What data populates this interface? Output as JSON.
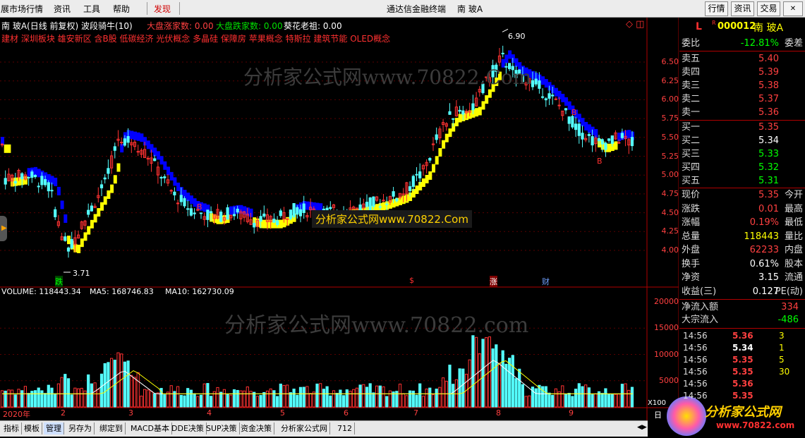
{
  "menu": {
    "items": [
      "展市场行情",
      "资讯",
      "工具",
      "帮助",
      "发现"
    ],
    "title": "通达信金融终端",
    "stock_title": "南 玻A",
    "right_buttons": [
      "行情",
      "资讯",
      "交易"
    ],
    "window_icons": [
      "▬",
      "▭",
      "✕"
    ]
  },
  "chart": {
    "stock_line": "南 玻A(日线 前复权) 波段骑牛(10)",
    "up_count_label": "大盘涨家数: 0.00",
    "down_count_label": "大盘跌家数: 0.00",
    "extra_label": "葵花老祖: 0.00",
    "concepts": "建材 深圳板块 雄安新区 含B股 低碳经济 光伏概念 多晶硅 保障房 苹果概念 特斯拉 建筑节能 OLED概念",
    "high_label": "6.90",
    "low_label": "3.71",
    "price_ticks": [
      "6.50",
      "6.25",
      "6.00",
      "5.75",
      "5.50",
      "5.25",
      "5.00",
      "4.75",
      "4.50",
      "4.25",
      "4.00"
    ],
    "event_tags": [
      "跌",
      "$",
      "涨",
      "财"
    ],
    "b_marks": [
      "B",
      "B",
      "B"
    ],
    "watermark1": "分析家公式网www.70822.Com",
    "watermark2": "分析家公式网www.70822.Com",
    "colors": {
      "up": "#ff3232",
      "down": "#54ffff",
      "band_up": "#ffff00",
      "band_down": "#0000ff",
      "ma": "#ffffff"
    }
  },
  "volume": {
    "label": "VOLUME: 118443.34",
    "ma5": "MA5: 168746.83",
    "ma10": "MA10: 162730.09",
    "ticks": [
      "20000",
      "15000",
      "10000",
      "5000"
    ],
    "unit": "X100",
    "watermark": "分析家公式网www.70822.com"
  },
  "date_axis": {
    "labels": [
      "2020年",
      "2",
      "3",
      "4",
      "5",
      "6",
      "7",
      "8",
      "9"
    ],
    "right_label": "日"
  },
  "bottom_tabs": [
    "指标",
    "模板",
    "管理",
    "另存为",
    "绑定到",
    "MACD基本",
    "DDE决策",
    "SUP决策",
    "资金决策",
    "分析家公式网",
    "712"
  ],
  "quote": {
    "market_icon": "L",
    "code": "000012",
    "name": "南 玻A",
    "r_icon": "R",
    "webi_label": "委比",
    "webi_value": "-12.81%",
    "weicha_label": "委差",
    "asks": [
      {
        "label": "卖五",
        "price": "5.40"
      },
      {
        "label": "卖四",
        "price": "5.39"
      },
      {
        "label": "卖三",
        "price": "5.38"
      },
      {
        "label": "卖二",
        "price": "5.37"
      },
      {
        "label": "卖一",
        "price": "5.36"
      }
    ],
    "bids": [
      {
        "label": "买一",
        "price": "5.35"
      },
      {
        "label": "买二",
        "price": "5.34"
      },
      {
        "label": "买三",
        "price": "5.33"
      },
      {
        "label": "买四",
        "price": "5.32"
      },
      {
        "label": "买五",
        "price": "5.31"
      }
    ],
    "stats": [
      {
        "label": "现价",
        "value": "5.35",
        "right": "今开"
      },
      {
        "label": "涨跌",
        "value": "0.01",
        "right": "最高"
      },
      {
        "label": "涨幅",
        "value": "0.19%",
        "right": "最低"
      },
      {
        "label": "总量",
        "value": "118443",
        "right": "量比"
      },
      {
        "label": "外盘",
        "value": "62233",
        "right": "内盘"
      },
      {
        "label": "换手",
        "value": "0.61%",
        "right": "股本"
      },
      {
        "label": "净资",
        "value": "3.15",
        "right": "流通"
      },
      {
        "label": "收益(三)",
        "value": "0.127",
        "right": "PE(动)"
      }
    ],
    "flow": [
      {
        "label": "净流入额",
        "value": "334"
      },
      {
        "label": "大宗流入",
        "value": "-486"
      }
    ],
    "ticks": [
      {
        "time": "14:56",
        "price": "5.36",
        "qty": "3"
      },
      {
        "time": "14:56",
        "price": "5.34",
        "qty": "1"
      },
      {
        "time": "14:56",
        "price": "5.35",
        "qty": "5"
      },
      {
        "time": "14:56",
        "price": "5.35",
        "qty": "30"
      },
      {
        "time": "14:56",
        "price": "5.36",
        "qty": ""
      },
      {
        "time": "14:56",
        "price": "5.35",
        "qty": ""
      }
    ],
    "logo_text": "分析家公式网",
    "logo_url": "www.70822.com"
  }
}
